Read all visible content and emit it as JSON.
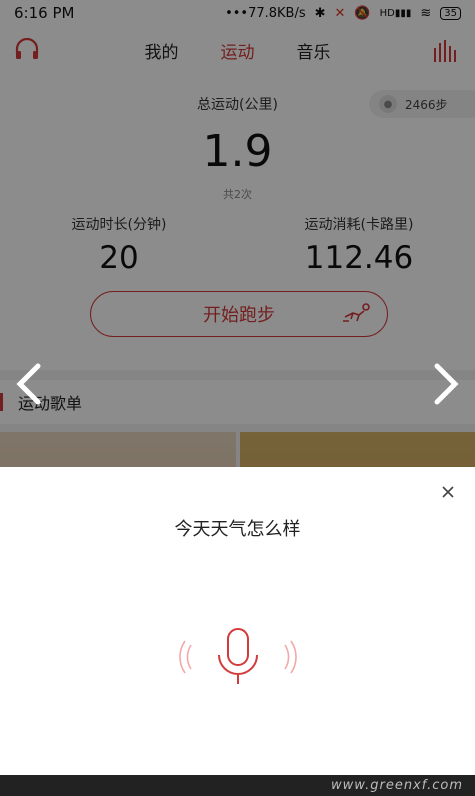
{
  "status_bar": {
    "time": "6:16 PM",
    "network_speed": "•••77.8KB/s",
    "battery": "35",
    "hd_label": "HD"
  },
  "nav": {
    "tabs": [
      {
        "label": "我的",
        "active": false
      },
      {
        "label": "运动",
        "active": true
      },
      {
        "label": "音乐",
        "active": false
      }
    ],
    "icons": {
      "left": "headphones-icon",
      "right": "equalizer-icon"
    }
  },
  "stats": {
    "total_label": "总运动(公里)",
    "total_value": "1.9",
    "total_count": "共2次",
    "steps": "2466步",
    "duration_label": "运动时长(分钟)",
    "duration_value": "20",
    "calories_label": "运动消耗(卡路里)",
    "calories_value": "112.46",
    "start_button": "开始跑步"
  },
  "playlist": {
    "section_title": "运动歌单"
  },
  "voice_dialog": {
    "query": "今天天气怎么样",
    "close_icon": "close-icon",
    "mic_icon": "microphone-icon"
  },
  "watermark": "www.greenxf.com",
  "colors": {
    "accent": "#d33a3a",
    "overlay": "rgba(0,0,0,0.45)"
  }
}
